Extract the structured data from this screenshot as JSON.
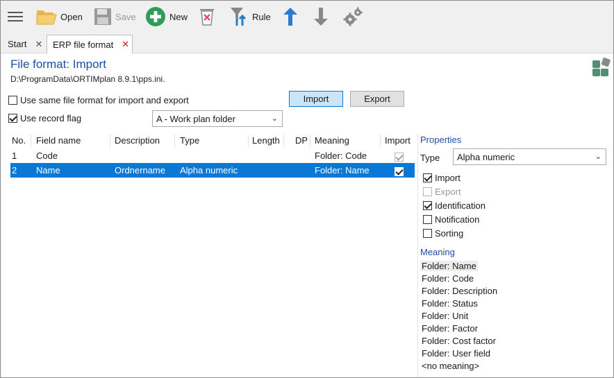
{
  "toolbar": {
    "open_label": "Open",
    "save_label": "Save",
    "new_label": "New",
    "rule_label": "Rule"
  },
  "tabs": [
    {
      "label": "Start",
      "close": "✕"
    },
    {
      "label": "ERP file format",
      "close": "✕"
    }
  ],
  "header": {
    "title": "File format: Import",
    "path": "D:\\ProgramData\\ORTIMplan 8.9.1\\pps.ini."
  },
  "options": {
    "same_format_label": "Use same file format for import and export",
    "same_format_checked": false,
    "record_flag_label": "Use record flag",
    "record_flag_checked": true,
    "record_select_value": "A - Work plan folder"
  },
  "mode_buttons": {
    "import_label": "Import",
    "export_label": "Export",
    "active": "import"
  },
  "grid": {
    "columns": [
      "No.",
      "Field name",
      "Description",
      "Type",
      "Length",
      "DP",
      "Meaning",
      "Import"
    ],
    "rows": [
      {
        "no": "1",
        "field": "Code",
        "description": "",
        "type": "",
        "length": "",
        "dp": "",
        "meaning": "Folder: Code",
        "import": true,
        "selected": false
      },
      {
        "no": "2",
        "field": "Name",
        "description": "Ordnername",
        "type": "Alpha numeric",
        "length": "",
        "dp": "",
        "meaning": "Folder: Name",
        "import": true,
        "selected": true
      }
    ]
  },
  "properties": {
    "title": "Properties",
    "type_label": "Type",
    "type_value": "Alpha numeric",
    "checks": [
      {
        "label": "Import",
        "checked": true,
        "disabled": false
      },
      {
        "label": "Export",
        "checked": false,
        "disabled": true
      },
      {
        "label": "Identification",
        "checked": true,
        "disabled": false
      },
      {
        "label": "Notification",
        "checked": false,
        "disabled": false
      },
      {
        "label": "Sorting",
        "checked": false,
        "disabled": false
      }
    ]
  },
  "meaning": {
    "title": "Meaning",
    "items": [
      "Folder: Name",
      "Folder: Code",
      "Folder: Description",
      "Folder: Status",
      "Folder: Unit",
      "Folder: Factor",
      "Folder: Cost factor",
      "Folder: User field",
      "<no meaning>"
    ],
    "selected_index": 0
  },
  "colors": {
    "accent": "#1b4fa3",
    "selection": "#0a78d7",
    "new_icon": "#2e9e57",
    "arrow_up": "#2b7bd1",
    "close_active": "#cc2211"
  }
}
